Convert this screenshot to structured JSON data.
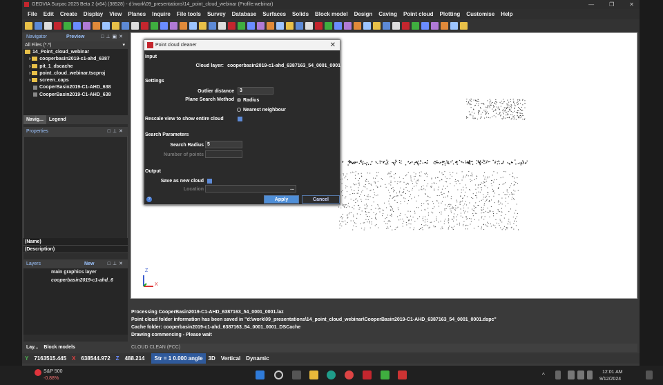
{
  "window": {
    "title": "GEOVIA Surpac 2025 Beta 2 (x64) (38528) - d:\\work\\09_presentations\\14_point_cloud_webinar (Profile:webinar)",
    "controls": [
      "—",
      "❐",
      "✕"
    ]
  },
  "menu": [
    "File",
    "Edit",
    "Create",
    "Display",
    "View",
    "Planes",
    "Inquire",
    "File tools",
    "Survey",
    "Database",
    "Surfaces",
    "Solids",
    "Block model",
    "Design",
    "Caving",
    "Point cloud",
    "Plotting",
    "Customise",
    "Help"
  ],
  "navigator": {
    "title": "Navigator",
    "preview": "Preview",
    "filter": "All Files (*.*)",
    "items": [
      "14_Point_cloud_webinar",
      "cooperbasin2019-c1-ahd_6387",
      "pit_1_dscache",
      "point_cloud_webinar.tscproj",
      "screen_caps",
      "CooperBasin2019-C1-AHD_638",
      "CooperBasin2019-C1-AHD_638"
    ],
    "tabs": [
      "Navig...",
      "Legend"
    ]
  },
  "properties": {
    "title": "Properties",
    "name_label": "(Name)",
    "desc_label": "(Description)"
  },
  "layers": {
    "title": "Layers",
    "new_label": "New",
    "items": [
      "main graphics layer",
      "cooperbasin2019-c1-ahd_6"
    ]
  },
  "bottom_tabs": [
    "Lay...",
    "Block models"
  ],
  "dialog": {
    "title": "Point cloud cleaner",
    "input_section": "Input",
    "cloud_layer_label": "Cloud layer:",
    "cloud_layer_value": "cooperbasin2019-c1-ahd_6387163_54_0001_0001",
    "settings_section": "Settings",
    "outlier_label": "Outlier distance",
    "outlier_value": "3",
    "plane_label": "Plane Search Method",
    "radius_option": "Radius",
    "nearest_option": "Nearest neighbour",
    "rescale_label": "Rescale view to show entire cloud",
    "search_section": "Search Parameters",
    "search_radius_label": "Search Radius",
    "search_radius_value": "5",
    "num_points_label": "Number of points",
    "output_section": "Output",
    "save_label": "Save as new cloud",
    "location_label": "Location",
    "browse": "...",
    "help": "?",
    "apply": "Apply",
    "cancel": "Cancel"
  },
  "console": [
    "Processing CooperBasin2019-C1-AHD_6387163_54_0001_0001.laz",
    "Point cloud folder information has been saved in \"d:\\work\\09_presentations\\14_point_cloud_webinar\\CooperBasin2019-C1-AHD_6387163_54_0001_0001.dspc\"",
    "Cache folder: cooperbasin2019-c1-ahd_6387163_54_0001_0001_DSCache",
    "Drawing commencing - Please wait"
  ],
  "command_line": "CLOUD CLEAN (PCC)",
  "status": {
    "y": "7163515.445",
    "x": "638544.972",
    "z": "488.214",
    "str_label": "Str = 1",
    "angle": "0.000 angle",
    "mode3d": "3D",
    "vertical": "Vertical",
    "dynamic": "Dynamic"
  },
  "axis": {
    "z": "Z",
    "x": "X"
  },
  "taskbar": {
    "stock_name": "S&P 500",
    "stock_change": "-0.88%",
    "time": "12:01 AM",
    "date": "9/12/2024",
    "tray_chevron": "^"
  }
}
